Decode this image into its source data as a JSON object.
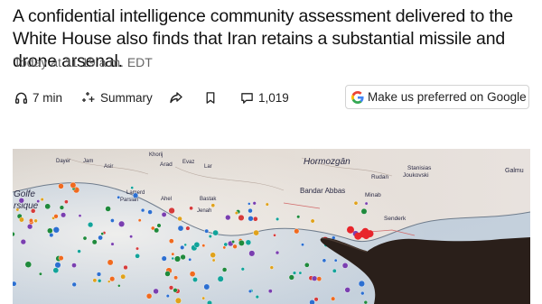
{
  "article": {
    "headline": "A confidential intelligence community assessment delivered to the White House also finds that Iran retains a substantial missile and drone arsenal.",
    "timestamp": "Today at 11:19 a.m. EDT"
  },
  "toolbar": {
    "listen_label": "7 min",
    "summary_label": "Summary",
    "comments_count": "1,019",
    "google_label": "Make us preferred on Google",
    "icons": [
      "headphones-icon",
      "sparkle-icon",
      "share-icon",
      "bookmark-icon",
      "comment-icon",
      "google-g-icon"
    ]
  },
  "photo": {
    "map_labels": [
      "Hormozgān",
      "Bandar Abbas",
      "Stanisias",
      "Joukovski",
      "Galmu",
      "Rudan",
      "Minab",
      "Senderk",
      "Khorij",
      "Arad",
      "Evaz",
      "Lar",
      "Asir",
      "Lamerd",
      "Parsian",
      "Bastak",
      "Jenah",
      "Golfe",
      "rsique",
      "Ahel",
      "Dayer",
      "Jam"
    ]
  }
}
